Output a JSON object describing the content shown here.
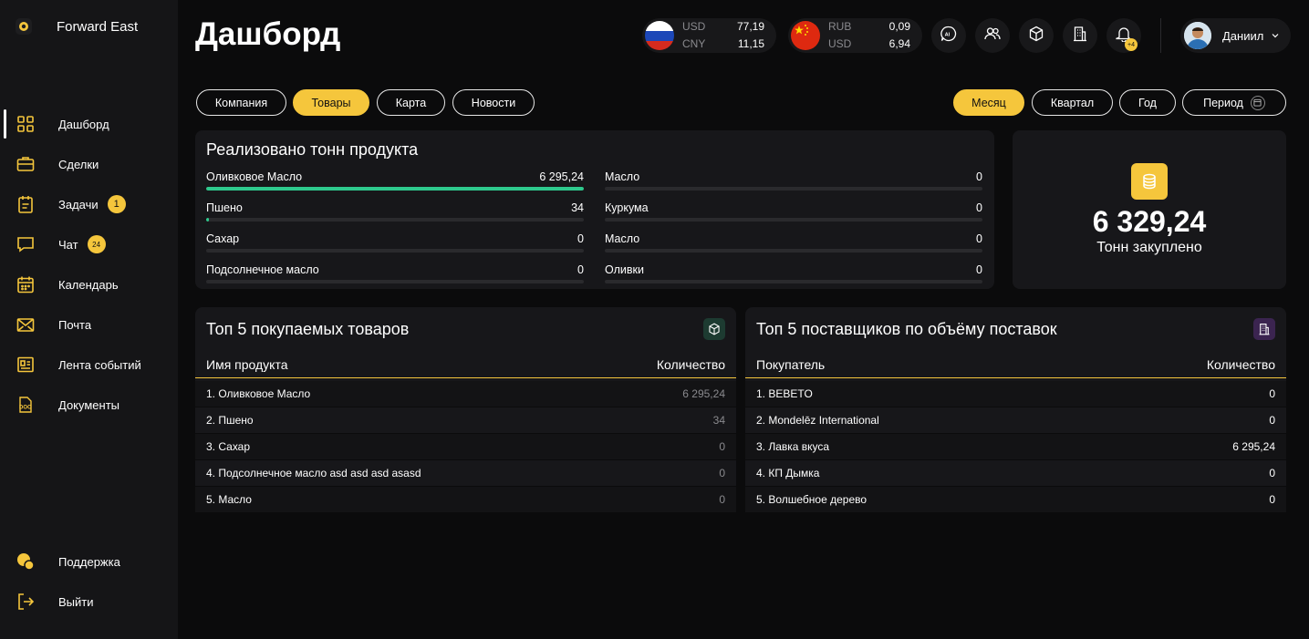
{
  "brand": {
    "name": "Forward East"
  },
  "nav": [
    {
      "label": "Дашборд",
      "icon": "dashboard-icon"
    },
    {
      "label": "Сделки",
      "icon": "briefcase-icon"
    },
    {
      "label": "Задачи",
      "icon": "tasks-icon",
      "badge": "1"
    },
    {
      "label": "Чат",
      "icon": "chat-icon",
      "badge": "24"
    },
    {
      "label": "Календарь",
      "icon": "calendar-icon"
    },
    {
      "label": "Почта",
      "icon": "mail-icon"
    },
    {
      "label": "Лента событий",
      "icon": "feed-icon"
    },
    {
      "label": "Документы",
      "icon": "doc-icon"
    }
  ],
  "nav_bottom": [
    {
      "label": "Поддержка",
      "icon": "support-icon"
    },
    {
      "label": "Выйти",
      "icon": "logout-icon"
    }
  ],
  "header": {
    "title": "Дашборд",
    "rate1": {
      "cur1": "USD",
      "cur2": "CNY",
      "val1": "77,19",
      "val2": "11,15"
    },
    "rate2": {
      "cur1": "RUB",
      "cur2": "USD",
      "val1": "0,09",
      "val2": "6,94"
    },
    "bell_badge": "+4",
    "user": "Даниил"
  },
  "tabs": [
    "Компания",
    "Товары",
    "Карта",
    "Новости"
  ],
  "periods": [
    "Месяц",
    "Квартал",
    "Год",
    "Период"
  ],
  "sold": {
    "title": "Реализовано тонн продукта",
    "left": [
      {
        "name": "Оливковое Масло",
        "value": "6 295,24",
        "share": 1.0
      },
      {
        "name": "Пшено",
        "value": "34",
        "share": 0.005
      },
      {
        "name": "Сахар",
        "value": "0",
        "share": 0
      },
      {
        "name": "Подсолнечное масло",
        "value": "0",
        "share": 0
      }
    ],
    "right": [
      {
        "name": "Масло",
        "value": "0",
        "share": 0
      },
      {
        "name": "Куркума",
        "value": "0",
        "share": 0
      },
      {
        "name": "Масло",
        "value": "0",
        "share": 0
      },
      {
        "name": "Оливки",
        "value": "0",
        "share": 0
      }
    ]
  },
  "purchased": {
    "value": "6 329,24",
    "label": "Тонн закуплено"
  },
  "top_products": {
    "title": "Топ 5 покупаемых товаров",
    "col1": "Имя продукта",
    "col2": "Количество",
    "rows": [
      {
        "name": "1. Оливковое Масло",
        "value": "6 295,24"
      },
      {
        "name": "2. Пшено",
        "value": "34"
      },
      {
        "name": "3. Сахар",
        "value": "0"
      },
      {
        "name": "4. Подсолнечное масло asd asd asd asasd",
        "value": "0"
      },
      {
        "name": "5. Масло",
        "value": "0"
      }
    ]
  },
  "top_suppliers": {
    "title": "Топ 5 поставщиков по объёму поставок",
    "col1": "Покупатель",
    "col2": "Количество",
    "rows": [
      {
        "name": "1. BEBETO",
        "value": "0"
      },
      {
        "name": "2. Mondelēz International",
        "value": "0"
      },
      {
        "name": "3. Лавка вкуса",
        "value": "6 295,24"
      },
      {
        "name": "4. КП Дымка",
        "value": "0"
      },
      {
        "name": "5. Волшебное дерево",
        "value": "0"
      }
    ]
  },
  "colors": {
    "accent": "#f5c63c",
    "progress": "#2ec98d",
    "bg": "#0b0b0c",
    "card": "#17171a"
  }
}
